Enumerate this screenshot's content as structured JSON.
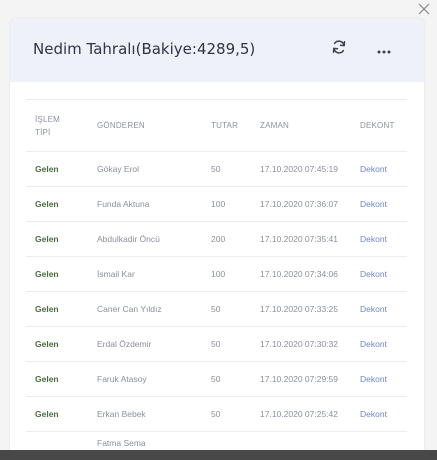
{
  "modal": {
    "title": "Nedim Tahralı(Bakiye:4289,5)",
    "refresh_icon": "refresh-icon",
    "more_icon": "more-horizontal-icon",
    "close_icon": "close-icon"
  },
  "table": {
    "headers": {
      "type": "İŞLEM TİPİ",
      "sender": "GÖNDEREN",
      "amount": "TUTAR",
      "time": "ZAMAN",
      "receipt": "DEKONT"
    },
    "rows": [
      {
        "type": "Gelen",
        "sender": "Gökay Erol",
        "amount": "50",
        "time": "17.10.2020 07:45:19",
        "receipt": "Dekont"
      },
      {
        "type": "Gelen",
        "sender": "Funda Aktuna",
        "amount": "100",
        "time": "17.10.2020 07:36:07",
        "receipt": "Dekont"
      },
      {
        "type": "Gelen",
        "sender": "Abdulkadir Öncü",
        "amount": "200",
        "time": "17.10.2020 07:35:41",
        "receipt": "Dekont"
      },
      {
        "type": "Gelen",
        "sender": "İsmail Kar",
        "amount": "100",
        "time": "17.10.2020 07:34:06",
        "receipt": "Dekont"
      },
      {
        "type": "Gelen",
        "sender": "Caner Can Yıldız",
        "amount": "50",
        "time": "17.10.2020 07:33:25",
        "receipt": "Dekont"
      },
      {
        "type": "Gelen",
        "sender": "Erdal Özdemir",
        "amount": "50",
        "time": "17.10.2020 07:30:32",
        "receipt": "Dekont"
      },
      {
        "type": "Gelen",
        "sender": "Faruk Atasoy",
        "amount": "50",
        "time": "17.10.2020 07:29:59",
        "receipt": "Dekont"
      },
      {
        "type": "Gelen",
        "sender": "Erkan Bebek",
        "amount": "50",
        "time": "17.10.2020 07:25:42",
        "receipt": "Dekont"
      },
      {
        "type": "",
        "sender": "Fatma Sema",
        "amount": "",
        "time": "",
        "receipt": ""
      }
    ]
  },
  "colors": {
    "header_bg": "#eef1f7",
    "type_text": "#4b6b3f",
    "link": "#6f86c9"
  }
}
